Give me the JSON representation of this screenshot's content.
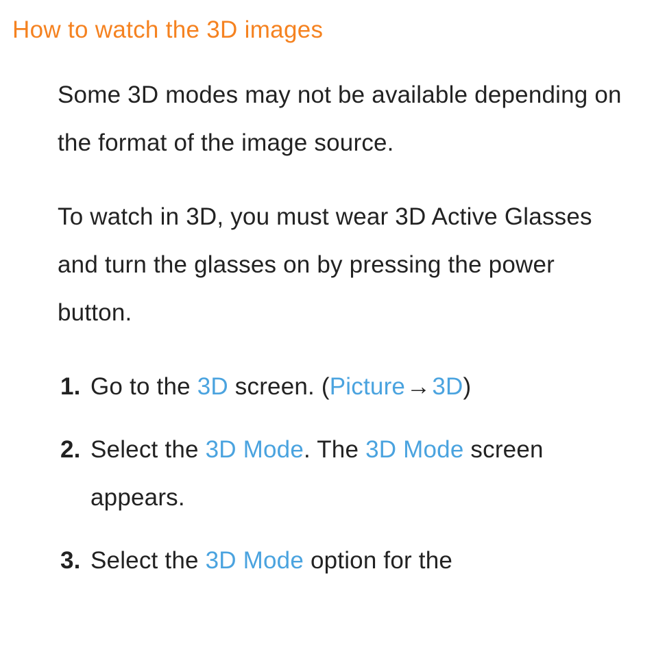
{
  "heading": "How to watch the 3D images",
  "paragraphs": [
    "Some 3D modes may not be available depending on the format of the image source.",
    "To watch in 3D, you must wear 3D Active Glasses and turn the glasses on by pressing the power button."
  ],
  "steps": [
    {
      "parts": [
        {
          "t": "Go to the "
        },
        {
          "t": "3D",
          "hl": true
        },
        {
          "t": " screen. ("
        },
        {
          "t": "Picture",
          "hl": true
        },
        {
          "t": " → ",
          "arrow": true
        },
        {
          "t": "3D",
          "hl": true
        },
        {
          "t": ")"
        }
      ]
    },
    {
      "parts": [
        {
          "t": "Select the "
        },
        {
          "t": "3D Mode",
          "hl": true
        },
        {
          "t": ". The "
        },
        {
          "t": "3D Mode",
          "hl": true
        },
        {
          "t": " screen appears."
        }
      ]
    },
    {
      "parts": [
        {
          "t": "Select the "
        },
        {
          "t": "3D Mode",
          "hl": true
        },
        {
          "t": " option for the"
        }
      ]
    }
  ]
}
